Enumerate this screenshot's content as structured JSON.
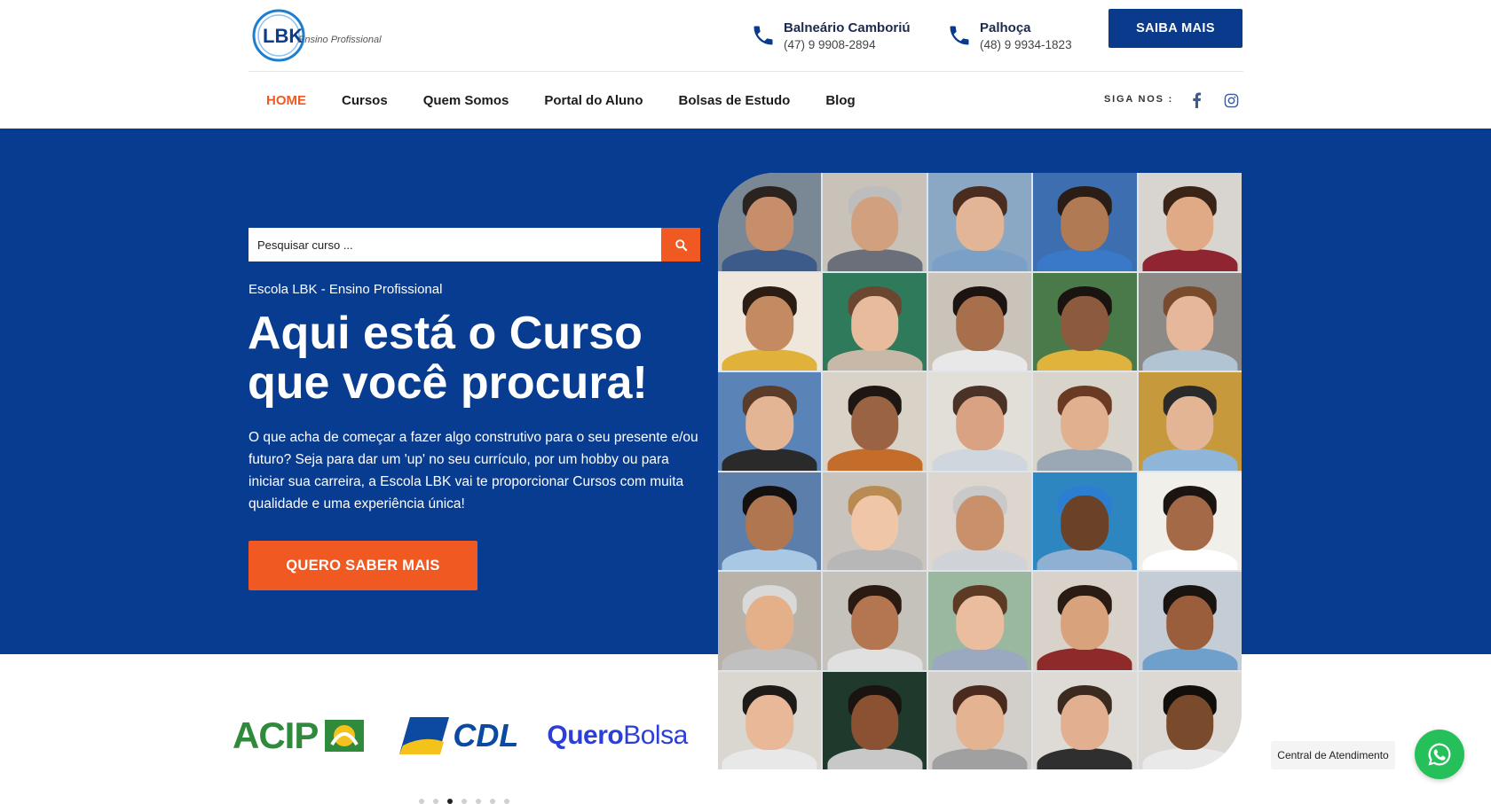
{
  "brand": {
    "logo_mark": "LBK",
    "logo_text": "Ensino Profissional"
  },
  "contacts": [
    {
      "city": "Balneário Camboriú",
      "phone": "(47) 9 9908-2894",
      "icon": "phone-icon"
    },
    {
      "city": "Palhoça",
      "phone": "(48) 9 9934-1823",
      "icon": "phone-icon"
    }
  ],
  "header": {
    "cta_label": "SAIBA MAIS"
  },
  "nav": {
    "items": [
      {
        "label": "HOME",
        "active": true
      },
      {
        "label": "Cursos"
      },
      {
        "label": "Quem Somos"
      },
      {
        "label": "Portal do Aluno"
      },
      {
        "label": "Bolsas de Estudo"
      },
      {
        "label": "Blog"
      }
    ],
    "social_label": "SIGA NOS :",
    "social": [
      "facebook-icon",
      "instagram-icon"
    ]
  },
  "hero": {
    "search_placeholder": "Pesquisar curso ...",
    "kicker": "Escola LBK - Ensino Profissional",
    "headline_line1": "Aqui está o Curso",
    "headline_line2": "que você procura!",
    "paragraph": "O que acha de começar a fazer algo construtivo para o seu presente e/ou futuro? Seja para dar um 'up' no seu currículo, por um hobby ou para iniciar sua carreira, a  Escola LBK vai te proporcionar Cursos com muita qualidade e uma experiência única!",
    "cta_label": "QUERO SABER MAIS"
  },
  "partners": {
    "acip": "ACIP",
    "cdl": "CDL",
    "querobolsa_a": "Quero",
    "querobolsa_b": "Bolsa"
  },
  "carousel": {
    "count": 7,
    "active_index": 2
  },
  "whatsapp": {
    "label": "Central de Atendimento",
    "icon": "whatsapp-icon"
  },
  "colors": {
    "primary_blue": "#083c91",
    "accent_orange": "#f05a22",
    "whatsapp_green": "#25c05a"
  }
}
